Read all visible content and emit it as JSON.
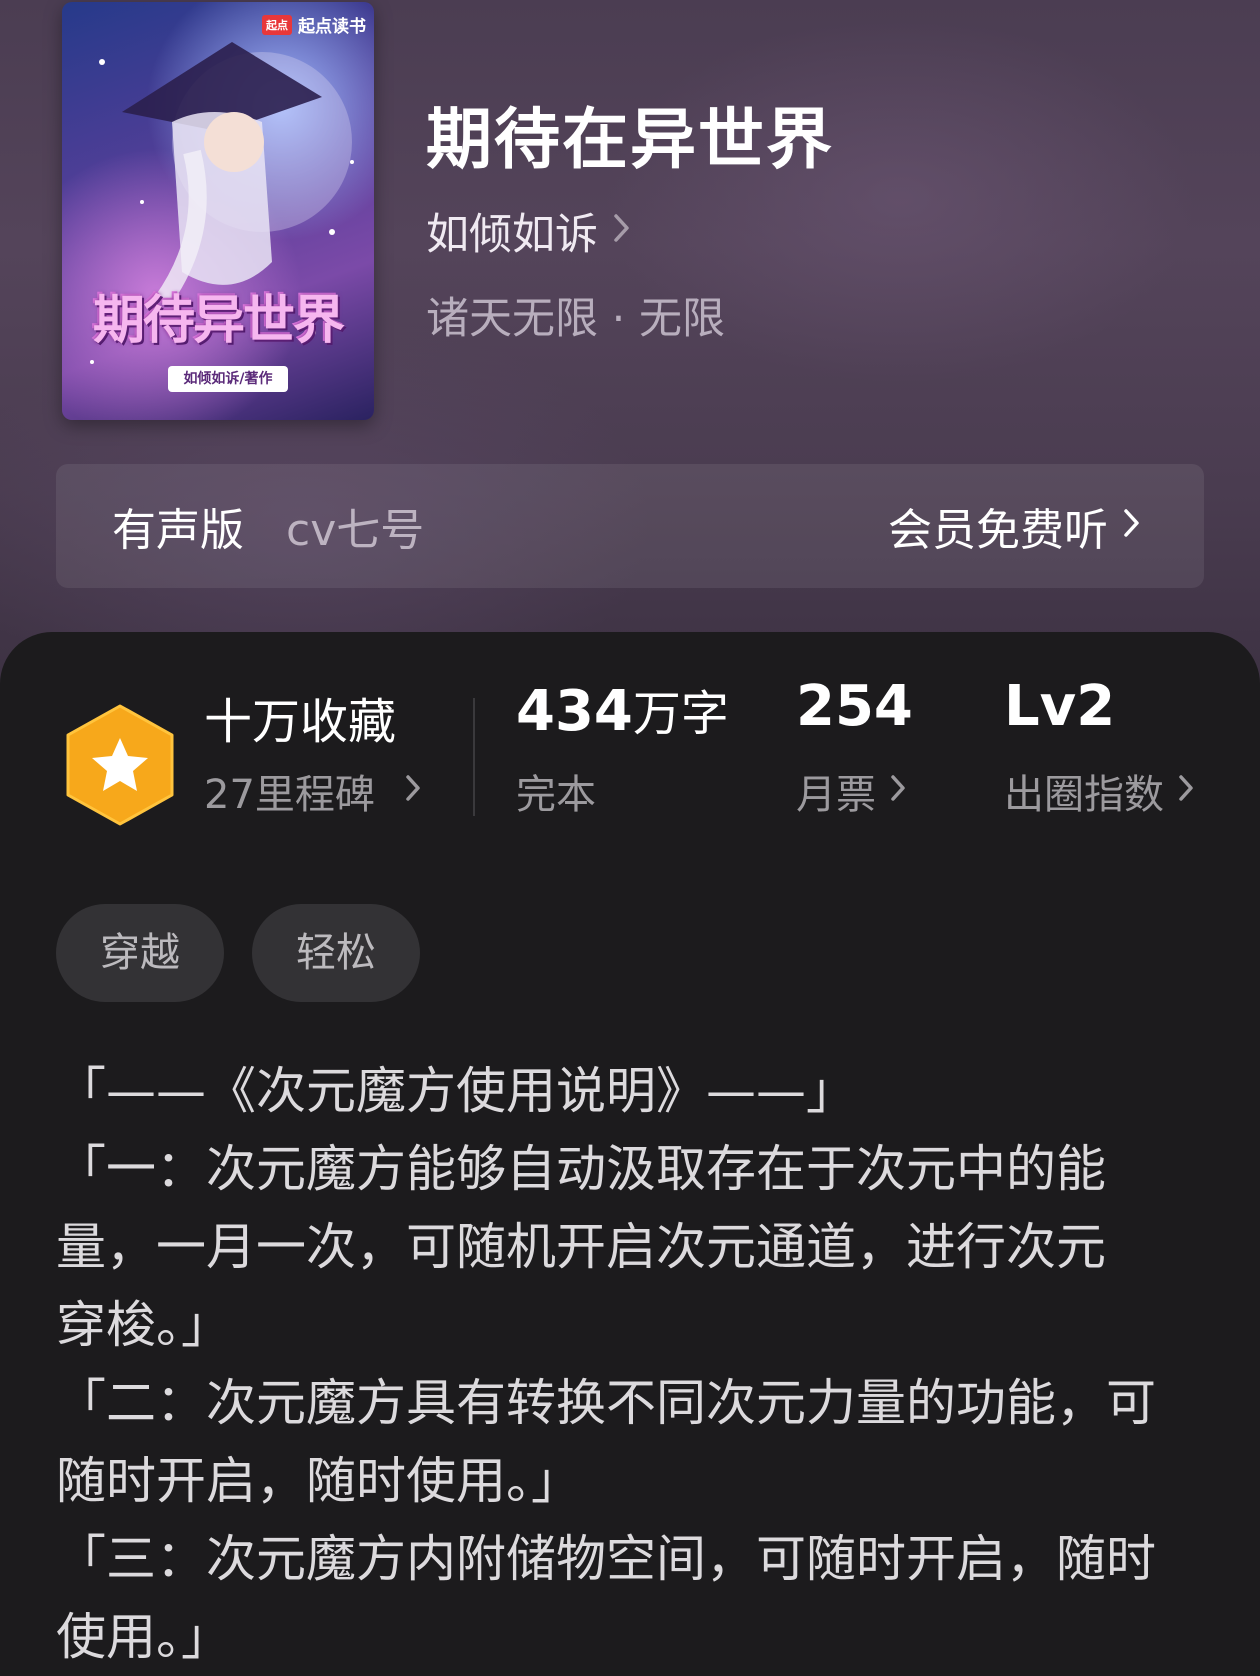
{
  "cover": {
    "brand": "起点读书",
    "brand_mark": "起点",
    "title_art": "期待异世界",
    "author_art": "如倾如诉/著作"
  },
  "book": {
    "title": "期待在异世界",
    "author": "如倾如诉",
    "genre": "诸天无限 · 无限"
  },
  "audio": {
    "label": "有声版",
    "narrator": "cv七号",
    "action": "会员免费听"
  },
  "stats": {
    "favorites_title": "十万收藏",
    "milestones": "27里程碑",
    "word_count_num": "434",
    "word_count_unit": "万字",
    "status": "完本",
    "monthly_votes": "254",
    "monthly_votes_label": "月票",
    "level": "Lv2",
    "level_label": "出圈指数"
  },
  "tags": [
    "穿越",
    "轻松"
  ],
  "synopsis": [
    "「——《次元魔方使用说明》——」",
    "「一：次元魔方能够自动汲取存在于次元中的能\n量，一月一次，可随机开启次元通道，进行次元\n穿梭。」",
    "「二：次元魔方具有转换不同次元力量的功能，可\n随时开启，随时使用。」",
    "「三：次元魔方内附储物空间，可随时开启，随时\n使用。」"
  ],
  "colors": {
    "header_bg": "#4b3d52",
    "panel_bg": "#1c1b1d",
    "badge_orange": "#f7a81b",
    "tag_bg": "#333235"
  }
}
